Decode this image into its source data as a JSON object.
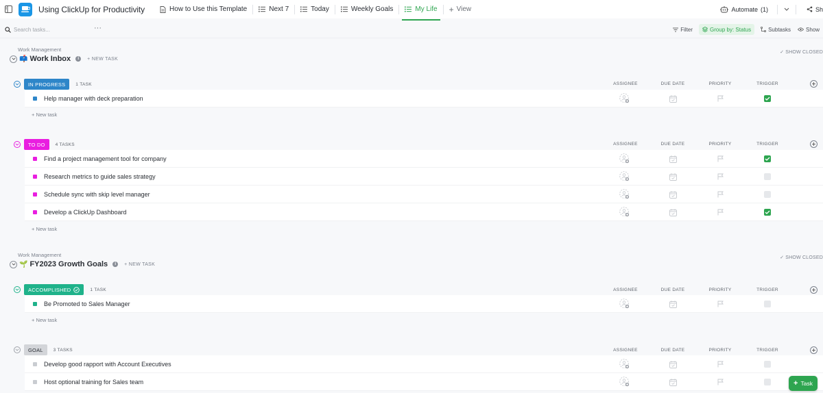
{
  "app": {
    "title": "Using ClickUp for Productivity"
  },
  "tabs": [
    {
      "label": "How to Use this Template",
      "icon": "doc-icon"
    },
    {
      "label": "Next 7",
      "icon": "list-icon"
    },
    {
      "label": "Today",
      "icon": "list-icon"
    },
    {
      "label": "Weekly Goals",
      "icon": "list-icon"
    },
    {
      "label": "My Life",
      "icon": "list-icon",
      "active": true
    }
  ],
  "add_view_label": "View",
  "automate": {
    "label": "Automate",
    "count": "(1)"
  },
  "share_label": "Sh",
  "toolbar": {
    "search_placeholder": "Search tasks...",
    "filter": "Filter",
    "group_by": "Group by: Status",
    "subtasks": "Subtasks",
    "show": "Show"
  },
  "colors": {
    "in_progress": "#2e86c9",
    "to_do": "#e91ee0",
    "accomplished": "#1fb28a",
    "goal": "#d3d5d9",
    "check_green": "#2ea550"
  },
  "columns": [
    "ASSIGNEE",
    "DUE DATE",
    "PRIORITY",
    "TRIGGER"
  ],
  "lists": [
    {
      "space": "Work Management",
      "emoji": "📫",
      "title": "Work Inbox",
      "new_task": "+ NEW TASK",
      "show_closed": "✓ SHOW CLOSED",
      "groups": [
        {
          "status": "IN PROGRESS",
          "count": "1 TASK",
          "tasks": [
            {
              "name": "Help manager with deck preparation",
              "trigger": true
            }
          ],
          "new_task": "+ New task"
        },
        {
          "status": "TO DO",
          "count": "4 TASKS",
          "tasks": [
            {
              "name": "Find a project management tool for company",
              "trigger": true
            },
            {
              "name": "Research metrics to guide sales strategy",
              "trigger": false
            },
            {
              "name": "Schedule sync with skip level manager",
              "trigger": false
            },
            {
              "name": "Develop a ClickUp Dashboard",
              "trigger": true
            }
          ],
          "new_task": "+ New task"
        }
      ]
    },
    {
      "space": "Work Management",
      "emoji": "🌱",
      "title": "FY2023 Growth Goals",
      "new_task": "+ NEW TASK",
      "show_closed": "✓ SHOW CLOSED",
      "groups": [
        {
          "status": "ACCOMPLISHED",
          "count": "1 TASK",
          "tasks": [
            {
              "name": "Be Promoted to Sales Manager",
              "trigger": false
            }
          ],
          "new_task": "+ New task"
        },
        {
          "status": "GOAL",
          "count": "3 TASKS",
          "tasks": [
            {
              "name": "Develop good rapport with Account Executives",
              "trigger": false
            },
            {
              "name": "Host optional training for Sales team",
              "trigger": false
            }
          ]
        }
      ]
    }
  ],
  "fab_label": "Task"
}
